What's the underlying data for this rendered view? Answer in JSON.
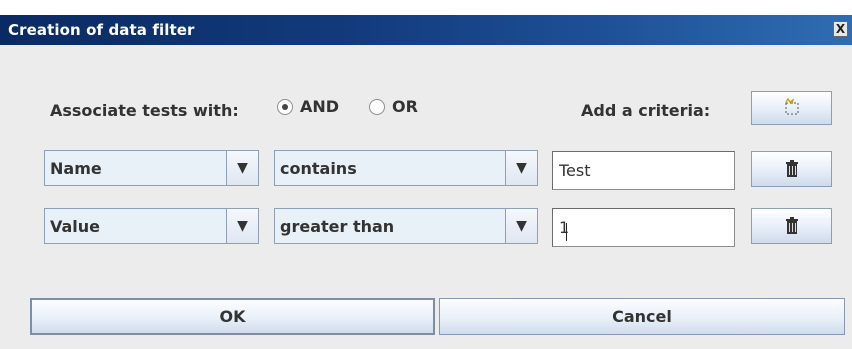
{
  "window": {
    "title": "Creation of data filter",
    "close_label": "X"
  },
  "filter": {
    "associate_label": "Associate tests with:",
    "and_label": "AND",
    "or_label": "OR",
    "selected_mode": "AND",
    "add_criteria_label": "Add a criteria:"
  },
  "criteria": [
    {
      "field": "Name",
      "operator": "contains",
      "value": "Test"
    },
    {
      "field": "Value",
      "operator": "greater than",
      "value": "1"
    }
  ],
  "buttons": {
    "ok_label": "OK",
    "cancel_label": "Cancel"
  },
  "icons": {
    "close": "close-icon",
    "add": "add-criteria-icon",
    "delete": "trash-icon",
    "dropdown": "chevron-down-icon"
  }
}
